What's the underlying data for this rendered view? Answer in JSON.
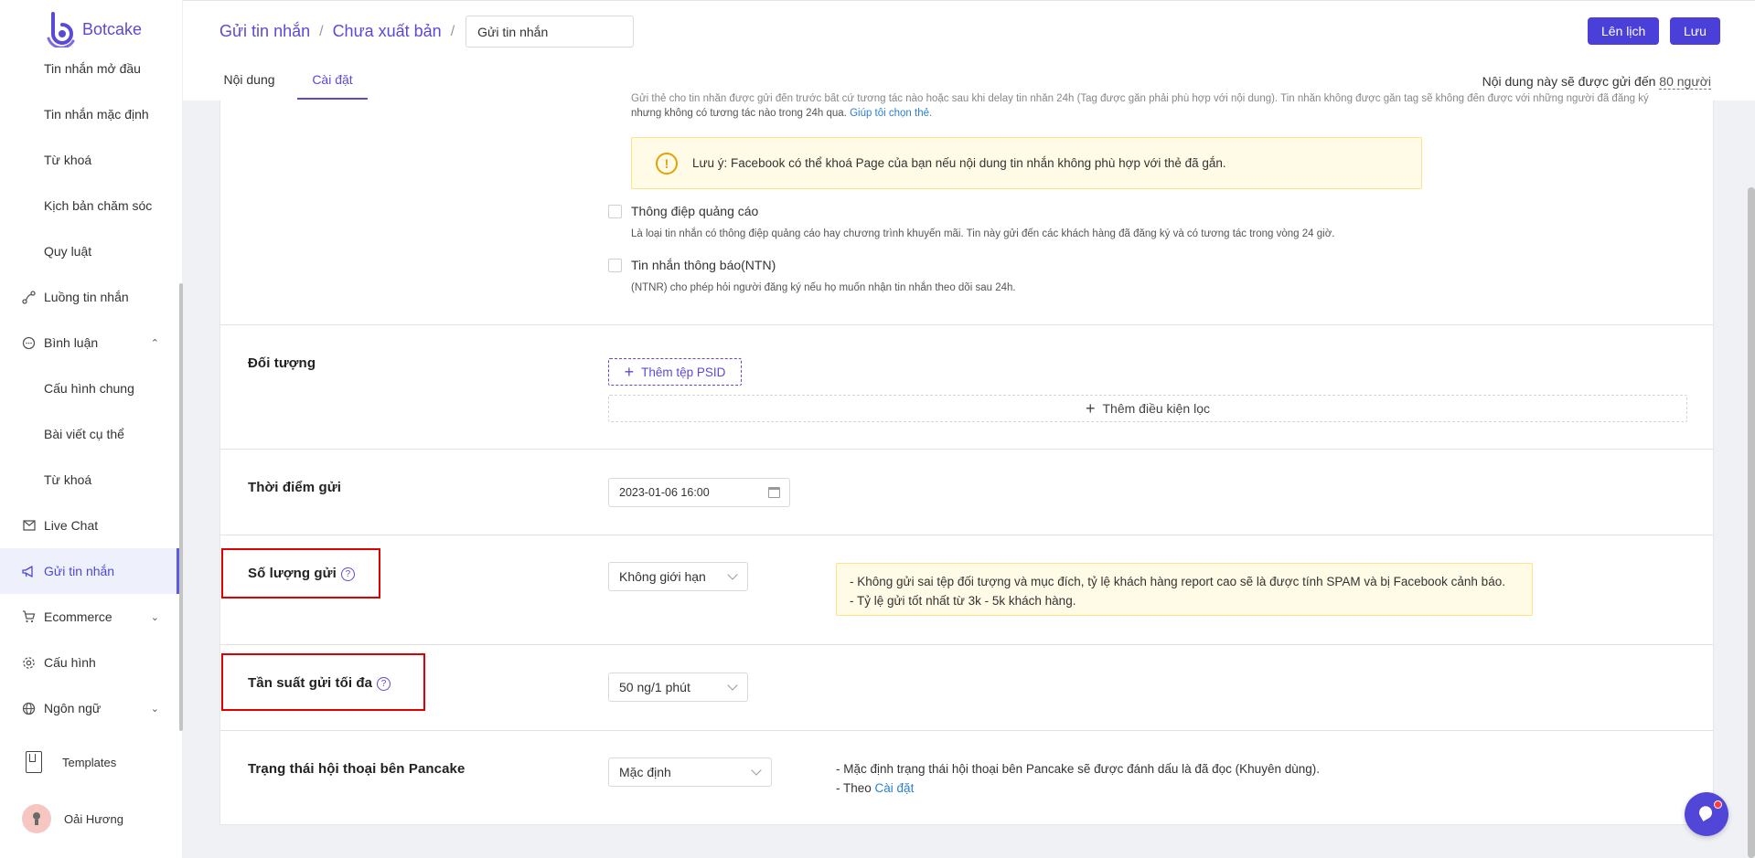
{
  "app": {
    "name": "Botcake"
  },
  "sidebar": {
    "items": [
      {
        "label": "Tin nhắn mở đầu",
        "type": "sub"
      },
      {
        "label": "Tin nhắn mặc định",
        "type": "sub"
      },
      {
        "label": "Từ khoá",
        "type": "sub"
      },
      {
        "label": "Kịch bản chăm sóc",
        "type": "sub"
      },
      {
        "label": "Quy luật",
        "type": "sub"
      },
      {
        "label": "Luồng tin nhắn",
        "type": "top",
        "icon": "flow-icon"
      },
      {
        "label": "Bình luận",
        "type": "top",
        "icon": "comment-icon",
        "chevron": "up"
      },
      {
        "label": "Cấu hình chung",
        "type": "sub"
      },
      {
        "label": "Bài viết cụ thể",
        "type": "sub"
      },
      {
        "label": "Từ khoá",
        "type": "sub"
      },
      {
        "label": "Live Chat",
        "type": "top",
        "icon": "mail-icon"
      },
      {
        "label": "Gửi tin nhắn",
        "type": "top",
        "icon": "megaphone-icon",
        "active": true
      },
      {
        "label": "Ecommerce",
        "type": "top",
        "icon": "cart-icon",
        "chevron": "down"
      },
      {
        "label": "Cấu hình",
        "type": "top",
        "icon": "gear-icon"
      },
      {
        "label": "Ngôn ngữ",
        "type": "top",
        "icon": "globe-icon",
        "chevron": "down"
      }
    ],
    "templates_label": "Templates",
    "user_name": "Oải Hương"
  },
  "header": {
    "breadcrumb": [
      "Gửi tin nhắn",
      "Chưa xuất bản"
    ],
    "name_input_value": "Gửi tin nhắn",
    "schedule_button": "Lên lịch",
    "save_button": "Lưu",
    "tabs": [
      "Nội dung",
      "Cài đặt"
    ],
    "recipient_note_prefix": "Nội dung này sẽ được gửi đến",
    "recipient_count": "80 người"
  },
  "content": {
    "top_desc_line1": "Gửi thẻ cho tin nhắn được gửi đến trước bất cứ tương tác nào hoặc sau khi delay tin nhắn 24h (Tag được gắn phải phù hợp với nội dung). Tin nhắn không được gắn tag sẽ không đến được với những người đã đăng ký",
    "top_desc_line2": "nhưng không có tương tác nào trong 24h qua.",
    "top_desc_link": "Giúp tôi chọn thẻ.",
    "warning": "Lưu ý: Facebook có thể khoá Page của bạn nếu nội dung tin nhắn không phù hợp với thẻ đã gắn.",
    "option_promo": "Thông điệp quảng cáo",
    "option_promo_desc": "Là loại tin nhắn có thông điệp quảng cáo hay chương trình khuyến mãi. Tin này gửi đến các khách hàng đã đăng ký và có tương tác trong vòng 24 giờ.",
    "option_ntn": "Tin nhắn thông báo(NTN)",
    "option_ntn_desc": "(NTNR) cho phép hỏi người đăng ký nếu họ muốn nhận tin nhắn theo dõi sau 24h.",
    "audience_label": "Đối tượng",
    "add_psid_button": "Thêm tệp PSID",
    "add_filter_button": "Thêm điều kiện lọc",
    "send_time_label": "Thời điểm gửi",
    "send_time_value": "2023-01-06 16:00",
    "quantity_label": "Số lượng gửi",
    "quantity_value": "Không giới hạn",
    "quantity_note_1": "- Không gửi sai tệp đối tượng và mục đích, tỷ lệ khách hàng report cao sẽ là được tính SPAM và bị Facebook cảnh báo.",
    "quantity_note_2": "- Tỷ lệ gửi tốt nhất từ 3k - 5k khách hàng.",
    "frequency_label": "Tần suất gửi tối đa",
    "frequency_value": "50 ng/1 phút",
    "status_label": "Trạng thái hội thoại bên Pancake",
    "status_value": "Mặc định",
    "status_note_1": "- Mặc định trạng thái hội thoại bên Pancake sẽ được đánh dấu là đã đọc (Khuyên dùng).",
    "status_note_2_prefix": "- Theo",
    "status_note_2_link": "Cài đặt"
  },
  "colors": {
    "brand": "#5b4ad6",
    "primary_button": "#4a3fd8",
    "highlight": "#e10000",
    "warning_bg": "#fffbe6"
  }
}
